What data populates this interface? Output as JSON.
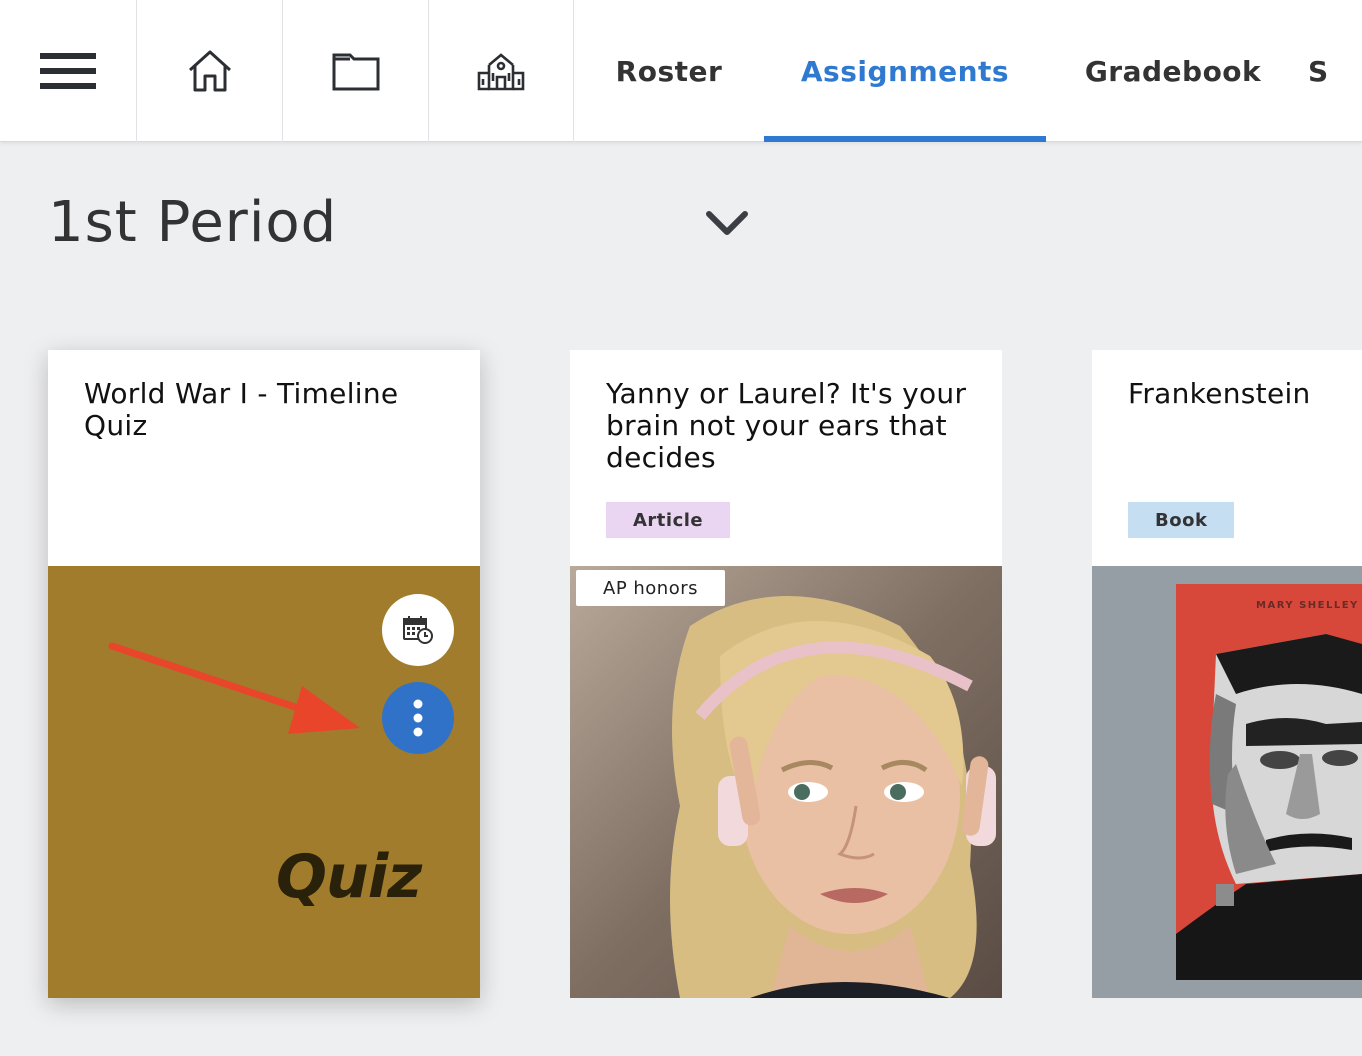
{
  "nav": {
    "menu_icon": "hamburger-menu-icon",
    "home_icon": "home-icon",
    "folder_icon": "folder-icon",
    "school_icon": "school-icon",
    "tabs": [
      {
        "label": "Roster",
        "active": false
      },
      {
        "label": "Assignments",
        "active": true
      },
      {
        "label": "Gradebook",
        "active": false
      },
      {
        "label": "S",
        "active": false
      }
    ]
  },
  "period": {
    "title": "1st Period",
    "chevron_icon": "chevron-down-icon"
  },
  "cards": [
    {
      "title": "World War I - Timeline Quiz",
      "media_label": "Quiz",
      "schedule_icon": "calendar-clock-icon",
      "more_icon": "more-vertical-icon",
      "annotation_icon": "red-arrow-icon"
    },
    {
      "title": "Yanny or Laurel? It's your brain not your ears that decides",
      "badge": "Article",
      "tag": "AP honors"
    },
    {
      "title": "Frankenstein",
      "badge": "Book",
      "cover_author": "MARY SHELLEY"
    }
  ],
  "colors": {
    "accent": "#2f7ad0",
    "quiz_background": "#a07c2c",
    "article_badge": "#ead5f3",
    "book_badge": "#c5def2",
    "annotation_arrow": "#e8452a"
  }
}
